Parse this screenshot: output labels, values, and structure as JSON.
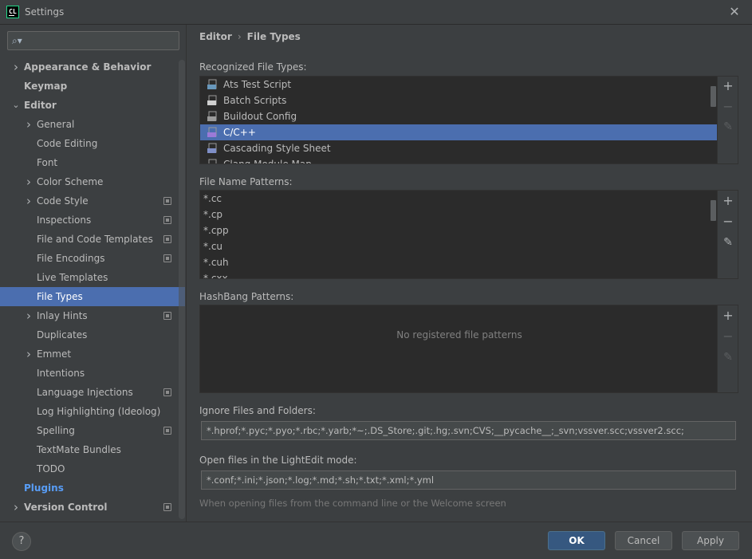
{
  "window": {
    "title": "Settings",
    "app_icon_text": "CL"
  },
  "search": {
    "placeholder": ""
  },
  "sidebar": {
    "items": [
      {
        "label": "Appearance & Behavior",
        "level": 0,
        "arrow": "right",
        "style": "bold"
      },
      {
        "label": "Keymap",
        "level": 0,
        "arrow": "",
        "style": "bold"
      },
      {
        "label": "Editor",
        "level": 0,
        "arrow": "down",
        "style": "bold"
      },
      {
        "label": "General",
        "level": 1,
        "arrow": "right"
      },
      {
        "label": "Code Editing",
        "level": 1,
        "arrow": ""
      },
      {
        "label": "Font",
        "level": 1,
        "arrow": ""
      },
      {
        "label": "Color Scheme",
        "level": 1,
        "arrow": "right"
      },
      {
        "label": "Code Style",
        "level": 1,
        "arrow": "right",
        "project": true
      },
      {
        "label": "Inspections",
        "level": 1,
        "arrow": "",
        "project": true
      },
      {
        "label": "File and Code Templates",
        "level": 1,
        "arrow": "",
        "project": true
      },
      {
        "label": "File Encodings",
        "level": 1,
        "arrow": "",
        "project": true
      },
      {
        "label": "Live Templates",
        "level": 1,
        "arrow": ""
      },
      {
        "label": "File Types",
        "level": 1,
        "arrow": "",
        "selected": true
      },
      {
        "label": "Inlay Hints",
        "level": 1,
        "arrow": "right",
        "project": true
      },
      {
        "label": "Duplicates",
        "level": 1,
        "arrow": ""
      },
      {
        "label": "Emmet",
        "level": 1,
        "arrow": "right"
      },
      {
        "label": "Intentions",
        "level": 1,
        "arrow": ""
      },
      {
        "label": "Language Injections",
        "level": 1,
        "arrow": "",
        "project": true
      },
      {
        "label": "Log Highlighting (Ideolog)",
        "level": 1,
        "arrow": ""
      },
      {
        "label": "Spelling",
        "level": 1,
        "arrow": "",
        "project": true
      },
      {
        "label": "TextMate Bundles",
        "level": 1,
        "arrow": ""
      },
      {
        "label": "TODO",
        "level": 1,
        "arrow": ""
      },
      {
        "label": "Plugins",
        "level": 0,
        "arrow": "",
        "style": "link"
      },
      {
        "label": "Version Control",
        "level": 0,
        "arrow": "right",
        "style": "bold",
        "project": true
      }
    ]
  },
  "breadcrumb": {
    "parent": "Editor",
    "separator": "›",
    "current": "File Types"
  },
  "recognized": {
    "label": "Recognized File Types:",
    "items": [
      {
        "label": "Ats Test Script",
        "icon": "ats-script-icon"
      },
      {
        "label": "Batch Scripts",
        "icon": "batch-script-icon"
      },
      {
        "label": "Buildout Config",
        "icon": "buildout-config-icon"
      },
      {
        "label": "C/C++",
        "icon": "cpp-file-icon",
        "selected": true
      },
      {
        "label": "Cascading Style Sheet",
        "icon": "css-file-icon"
      },
      {
        "label": "Clang Module Map",
        "icon": "clang-module-map-icon"
      }
    ]
  },
  "patterns": {
    "label": "File Name Patterns:",
    "items": [
      "*.cc",
      "*.cp",
      "*.cpp",
      "*.cu",
      "*.cuh",
      "*.cxx"
    ]
  },
  "hashbang": {
    "label": "HashBang Patterns:",
    "empty_text": "No registered file patterns"
  },
  "ignore": {
    "label": "Ignore Files and Folders:",
    "value": "*.hprof;*.pyc;*.pyo;*.rbc;*.yarb;*~;.DS_Store;.git;.hg;.svn;CVS;__pycache__;_svn;vssver.scc;vssver2.scc;"
  },
  "lightedit": {
    "label": "Open files in the LightEdit mode:",
    "value": "*.conf;*.ini;*.json;*.log;*.md;*.sh;*.txt;*.xml;*.yml",
    "hint": "When opening files from the command line or the Welcome screen"
  },
  "toolbar": {
    "add": "+",
    "remove": "−",
    "edit": "✎"
  },
  "footer": {
    "help": "?",
    "ok": "OK",
    "cancel": "Cancel",
    "apply": "Apply"
  },
  "colors": {
    "selection": "#4b6eaf",
    "background": "#3c3f41",
    "list_bg": "#2b2b2b",
    "link": "#589df6",
    "primary_button": "#365880"
  }
}
